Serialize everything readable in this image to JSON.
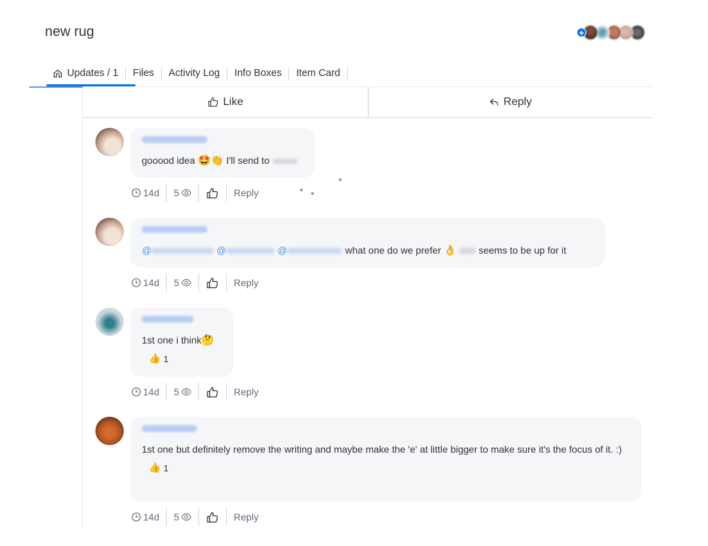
{
  "header": {
    "title": "new rug",
    "subscriber_count_shown": 5
  },
  "tabs": [
    {
      "label": "Updates / 1",
      "icon": "home-icon",
      "active": true
    },
    {
      "label": "Files",
      "active": false
    },
    {
      "label": "Activity Log",
      "active": false
    },
    {
      "label": "Info Boxes",
      "active": false
    },
    {
      "label": "Item Card",
      "active": false
    }
  ],
  "actions": {
    "like_label": "Like",
    "reply_label": "Reply"
  },
  "replies": [
    {
      "author": "(blurred name)",
      "text_before": "gooood idea ",
      "emojis": "🤩👏",
      "text_after": " I'll send to",
      "time": "14d",
      "views": "5",
      "reply_label": "Reply"
    },
    {
      "author": "(blurred name)",
      "mentions": [
        "@",
        "@",
        "@"
      ],
      "text": " what one do we prefer ",
      "emoji": "👌",
      "text_after": " seems to be up for it",
      "time": "14d",
      "views": "5",
      "reply_label": "Reply"
    },
    {
      "author": "(blurred name)",
      "text": "1st one i think",
      "emoji": "🤔",
      "reaction_emoji": "👍",
      "reaction_count": "1",
      "time": "14d",
      "views": "5",
      "reply_label": "Reply"
    },
    {
      "author": "(blurred name)",
      "text": "1st one but definitely remove the writing and maybe make the 'e' at little bigger to make sure it's the focus of it. :)",
      "reaction_emoji": "👍",
      "reaction_count": "1",
      "time": "14d",
      "views": "5",
      "reply_label": "Reply"
    }
  ],
  "colors": {
    "accent": "#0073ea",
    "mention": "#4a90e2",
    "bubble": "#f5f6f8"
  }
}
